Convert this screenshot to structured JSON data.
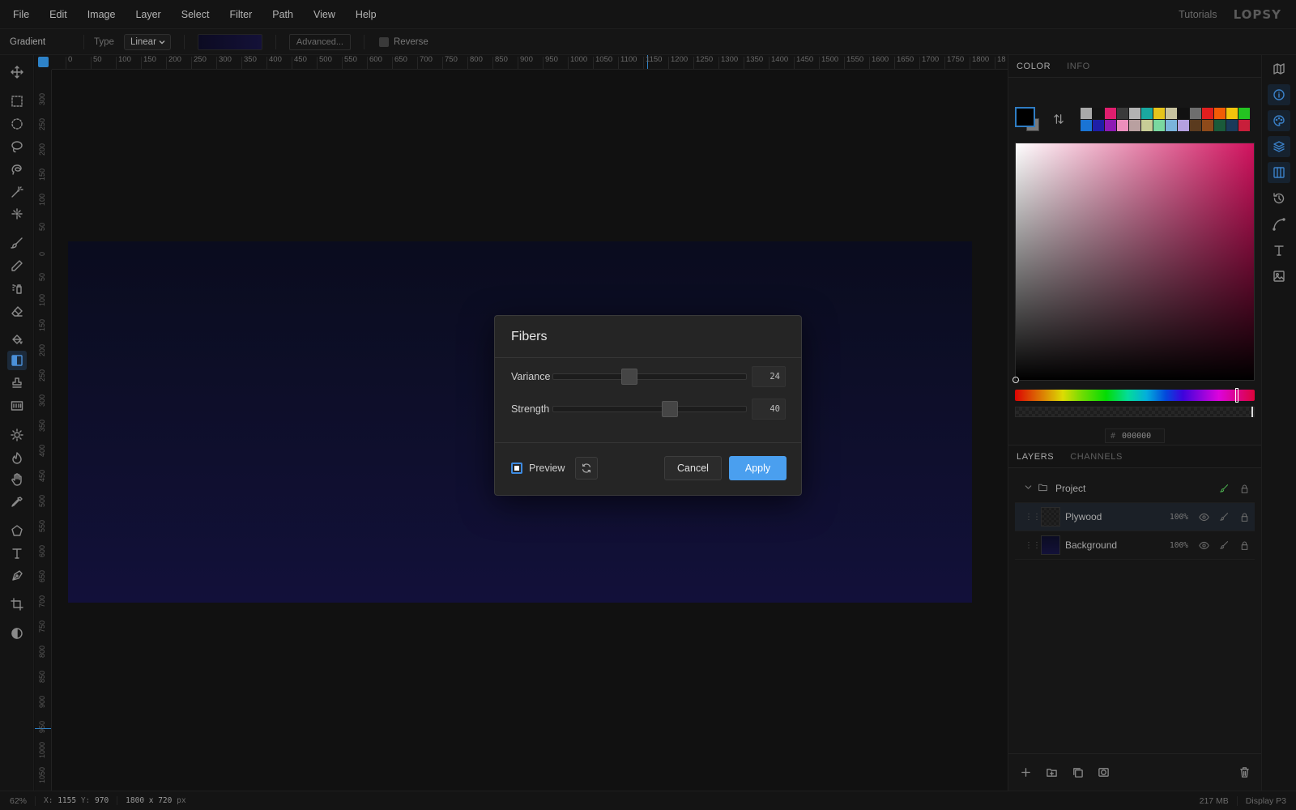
{
  "menubar": {
    "items": [
      "File",
      "Edit",
      "Image",
      "Layer",
      "Select",
      "Filter",
      "Path",
      "View",
      "Help"
    ],
    "tutorials": "Tutorials",
    "logo": "LOPSY"
  },
  "options": {
    "tool_name": "Gradient",
    "type_label": "Type",
    "type_value": "Linear",
    "advanced_label": "Advanced...",
    "reverse_label": "Reverse",
    "reverse_checked": false
  },
  "tools": [
    "move-icon",
    "rect-select-icon",
    "ellipse-select-icon",
    "lasso-icon",
    "magnetic-lasso-icon",
    "magic-wand-icon",
    "quick-select-icon",
    "brush-icon",
    "pencil-icon",
    "spray-icon",
    "eraser-icon",
    "fill-bucket-icon",
    "gradient-icon",
    "clone-stamp-icon",
    "pattern-icon",
    "brightness-icon",
    "burn-icon",
    "smudge-icon",
    "eyedropper-icon",
    "polygon-icon",
    "text-icon",
    "pen-icon",
    "crop-icon",
    "contrast-icon"
  ],
  "active_tool": "gradient-icon",
  "ruler": {
    "h_ticks": [
      "0",
      "50",
      "100",
      "150",
      "200",
      "250",
      "300",
      "350",
      "400",
      "450",
      "500",
      "550",
      "600",
      "650",
      "700",
      "750",
      "800",
      "850",
      "900",
      "950",
      "1000",
      "1050",
      "1100",
      "1150",
      "1200",
      "1250",
      "1300",
      "1350",
      "1400",
      "1450",
      "1500",
      "1550",
      "1600",
      "1650",
      "1700",
      "1750",
      "1800",
      "18"
    ],
    "v_ticks": [
      "300",
      "250",
      "200",
      "150",
      "100",
      "50",
      "0",
      "50",
      "100",
      "150",
      "200",
      "250",
      "300",
      "350",
      "400",
      "450",
      "500",
      "550",
      "600",
      "650",
      "700",
      "750",
      "800",
      "850",
      "900",
      "950",
      "1000",
      "1050"
    ]
  },
  "right_panel": {
    "color_tabs": [
      "COLOR",
      "INFO"
    ],
    "active_color_tab": "COLOR",
    "swatches": [
      "#a9a9a9",
      "#141414",
      "#e01e6e",
      "#3a3a3a",
      "#b3b3b3",
      "#1aa8a0",
      "#e6c41c",
      "#c8c3a0",
      "#111111",
      "#6e6e6e",
      "#e01e1e",
      "#f25c05",
      "#f2c40c",
      "#24c421",
      "#1a74d4",
      "#1e1ea8",
      "#8e1ab4",
      "#ec8ebc",
      "#b9a0a0",
      "#c8cc96",
      "#7ad8a0",
      "#7ab4dc",
      "#b4a0e0",
      "#5a3a1e",
      "#8e4a1a",
      "#1a5a3a",
      "#1a3a5a",
      "#c81e3a"
    ],
    "hex_value": "000000",
    "layers_tabs": [
      "LAYERS",
      "CHANNELS"
    ],
    "active_layers_tab": "LAYERS",
    "group_name": "Project",
    "layers": [
      {
        "name": "Plywood",
        "opacity": "100%",
        "selected": true
      },
      {
        "name": "Background",
        "opacity": "100%",
        "selected": false
      }
    ]
  },
  "icon_strip": [
    "map-icon",
    "info-icon",
    "palette-icon",
    "layers-icon",
    "columns-icon",
    "history-icon",
    "curve-icon",
    "text-icon",
    "image-icon"
  ],
  "status": {
    "zoom": "62%",
    "x_label": "X:",
    "x_value": "1155",
    "y_label": "Y:",
    "y_value": "970",
    "dims_value": "1800 x 720",
    "dims_unit": "px",
    "memory": "217 MB",
    "display": "Display P3"
  },
  "dialog": {
    "title": "Fibers",
    "variance_label": "Variance",
    "variance_value": "24",
    "variance_fraction": 0.38,
    "strength_label": "Strength",
    "strength_value": "40",
    "strength_fraction": 0.61,
    "preview_label": "Preview",
    "preview_checked": true,
    "cancel_label": "Cancel",
    "apply_label": "Apply"
  }
}
